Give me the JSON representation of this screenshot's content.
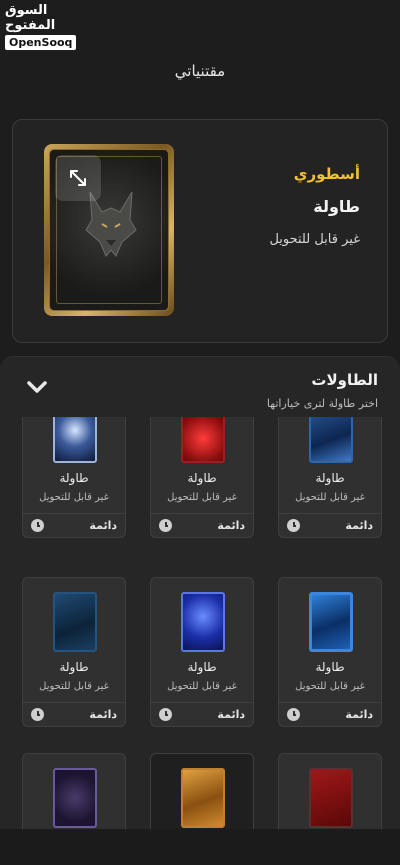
{
  "watermark": {
    "arabic": "السوق المفتوح",
    "english": "OpenSooq"
  },
  "page": {
    "title": "مقتنياتي"
  },
  "featured": {
    "rarity": "أسطوري",
    "name": "طاولة",
    "transfer": "غير قابل للتحويل",
    "rarity_color": "#f2c230",
    "expand_icon": "expand-icon"
  },
  "tables": {
    "title": "الطاولات",
    "subtitle": "اختر طاولة لترى خياراتها",
    "items": [
      {
        "name": "طاولة",
        "transfer": "غير قابل للتحويل",
        "duration": "دائمة"
      },
      {
        "name": "طاولة",
        "transfer": "غير قابل للتحويل",
        "duration": "دائمة"
      },
      {
        "name": "طاولة",
        "transfer": "غير قابل للتحويل",
        "duration": "دائمة"
      },
      {
        "name": "طاولة",
        "transfer": "غير قابل للتحويل",
        "duration": "دائمة"
      },
      {
        "name": "طاولة",
        "transfer": "غير قابل للتحويل",
        "duration": "دائمة"
      },
      {
        "name": "طاولة",
        "transfer": "غير قابل للتحويل",
        "duration": "دائمة"
      },
      {
        "name": "",
        "transfer": "",
        "duration": ""
      },
      {
        "name": "",
        "transfer": "",
        "duration": ""
      },
      {
        "name": "",
        "transfer": "",
        "duration": ""
      }
    ]
  },
  "colors": {
    "background": "#1d1d1d",
    "panel": "#262626",
    "card": "#303031",
    "accent": "#f2c230"
  }
}
